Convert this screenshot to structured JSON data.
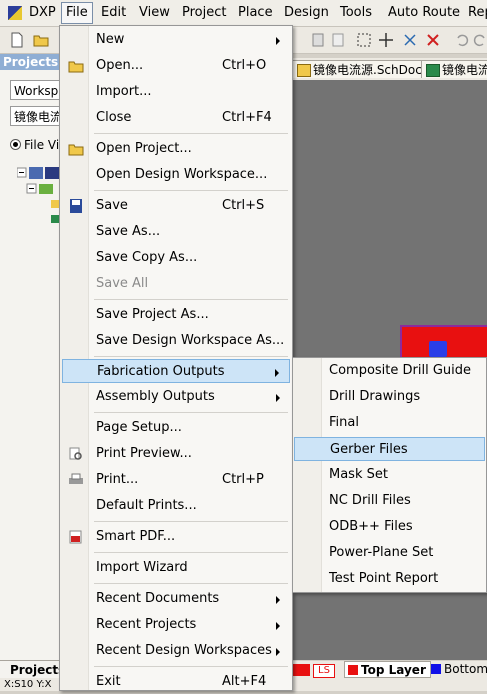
{
  "menubar": {
    "app": "DXP",
    "items": [
      "File",
      "Edit",
      "View",
      "Project",
      "Place",
      "Design",
      "Tools",
      "Auto Route",
      "Rep"
    ]
  },
  "panel": {
    "title": "Projects",
    "workspace_box": "Workspac",
    "project_box": "镜像电流",
    "radio_label": "File Vie",
    "bottom_tab": "Projects",
    "status_text": "X:S10 Y:X"
  },
  "doc_tabs": [
    {
      "label": "镜像电流源.SchDoc"
    },
    {
      "label": "镜像电流"
    }
  ],
  "layers": {
    "ls": "LS",
    "top": "Top Layer",
    "bottom": "Bottom L"
  },
  "file_menu": {
    "items": [
      {
        "label": "New",
        "shortcut": "",
        "submenu": true
      },
      {
        "label": "Open...",
        "shortcut": "Ctrl+O"
      },
      {
        "label": "Import...",
        "shortcut": ""
      },
      {
        "label": "Close",
        "shortcut": "Ctrl+F4"
      },
      {
        "label": "Open Project...",
        "shortcut": ""
      },
      {
        "label": "Open Design Workspace...",
        "shortcut": ""
      },
      {
        "label": "Save",
        "shortcut": "Ctrl+S"
      },
      {
        "label": "Save As...",
        "shortcut": ""
      },
      {
        "label": "Save Copy As...",
        "shortcut": ""
      },
      {
        "label": "Save All",
        "shortcut": "",
        "disabled": true
      },
      {
        "label": "Save Project As...",
        "shortcut": ""
      },
      {
        "label": "Save Design Workspace As...",
        "shortcut": ""
      },
      {
        "label": "Fabrication Outputs",
        "shortcut": "",
        "submenu": true,
        "highlighted": true
      },
      {
        "label": "Assembly Outputs",
        "shortcut": "",
        "submenu": true
      },
      {
        "label": "Page Setup...",
        "shortcut": ""
      },
      {
        "label": "Print Preview...",
        "shortcut": ""
      },
      {
        "label": "Print...",
        "shortcut": "Ctrl+P"
      },
      {
        "label": "Default Prints...",
        "shortcut": ""
      },
      {
        "label": "Smart PDF...",
        "shortcut": ""
      },
      {
        "label": "Import Wizard",
        "shortcut": ""
      },
      {
        "label": "Recent Documents",
        "shortcut": "",
        "submenu": true
      },
      {
        "label": "Recent Projects",
        "shortcut": "",
        "submenu": true
      },
      {
        "label": "Recent Design Workspaces",
        "shortcut": "",
        "submenu": true
      },
      {
        "label": "Exit",
        "shortcut": "Alt+F4"
      }
    ]
  },
  "fabrication_submenu": {
    "items": [
      {
        "label": "Composite Drill Guide"
      },
      {
        "label": "Drill Drawings"
      },
      {
        "label": "Final"
      },
      {
        "label": "Gerber Files",
        "highlighted": true
      },
      {
        "label": "Mask Set"
      },
      {
        "label": "NC Drill Files"
      },
      {
        "label": "ODB++ Files"
      },
      {
        "label": "Power-Plane Set"
      },
      {
        "label": "Test Point Report"
      }
    ]
  },
  "colors": {
    "highlight": "#cde4f7",
    "highlight_border": "#7fb3e0",
    "pcb_red": "#e81010",
    "panel_header": "#8faed4"
  }
}
